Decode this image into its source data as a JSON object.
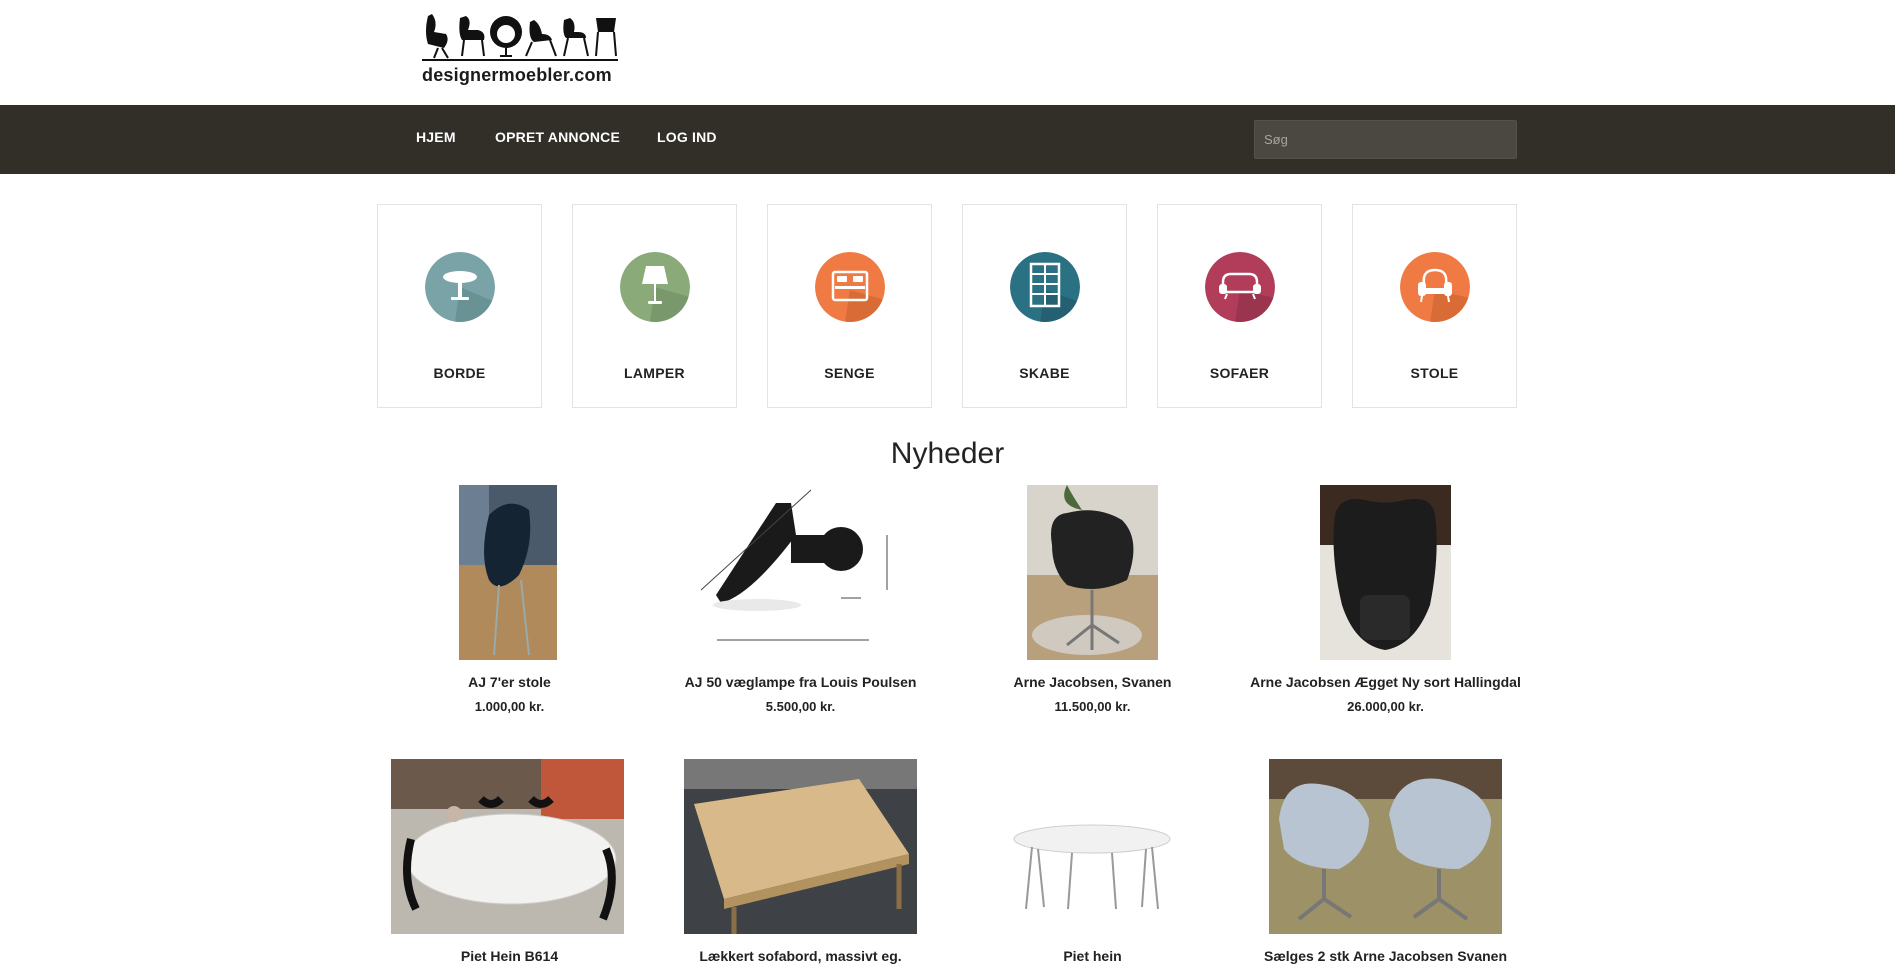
{
  "logo": {
    "text": "designermoebler.com"
  },
  "nav": {
    "items": [
      {
        "label": "HJEM"
      },
      {
        "label": "OPRET ANNONCE"
      },
      {
        "label": "LOG IND"
      }
    ],
    "search_placeholder": "Søg"
  },
  "categories": [
    {
      "label": "BORDE",
      "icon": "table-icon",
      "color": "#79a3a6"
    },
    {
      "label": "LAMPER",
      "icon": "lamp-icon",
      "color": "#8aaa7a"
    },
    {
      "label": "SENGE",
      "icon": "bed-icon",
      "color": "#f07a44"
    },
    {
      "label": "SKABE",
      "icon": "cabinet-icon",
      "color": "#2b7184"
    },
    {
      "label": "SOFAER",
      "icon": "sofa-icon",
      "color": "#b13d5a"
    },
    {
      "label": "STOLE",
      "icon": "armchair-icon",
      "color": "#f07a44"
    }
  ],
  "section": {
    "title": "Nyheder"
  },
  "products": [
    {
      "name": "AJ 7'er stole",
      "price": "1.000,00 kr."
    },
    {
      "name": "AJ 50 væglampe fra Louis Poulsen",
      "price": "5.500,00 kr."
    },
    {
      "name": "Arne Jacobsen, Svanen",
      "price": "11.500,00 kr."
    },
    {
      "name": "Arne Jacobsen Ægget Ny sort Hallingdal",
      "price": "26.000,00 kr."
    },
    {
      "name": "Piet Hein B614",
      "price": ""
    },
    {
      "name": "Lækkert sofabord, massivt eg.",
      "price": ""
    },
    {
      "name": "Piet hein",
      "price": ""
    },
    {
      "name": "Sælges 2 stk Arne Jacobsen Svanen",
      "price": ""
    }
  ]
}
